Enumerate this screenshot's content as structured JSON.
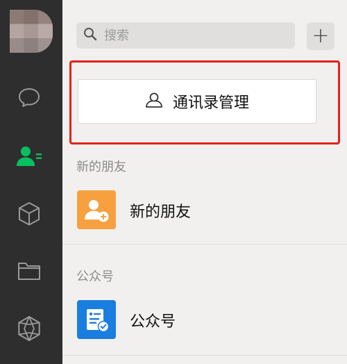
{
  "search": {
    "placeholder": "搜索"
  },
  "toolbar": {
    "add_label": "+"
  },
  "contacts_management": {
    "label": "通讯录管理"
  },
  "sections": [
    {
      "header": "新的朋友",
      "item_title": "新的朋友",
      "icon": "new-friend-icon",
      "color": "#f7a040"
    },
    {
      "header": "公众号",
      "item_title": "公众号",
      "icon": "official-account-icon",
      "color": "#1a7de0"
    }
  ],
  "colors": {
    "active_nav": "#07c160",
    "nav_bg": "#2e2e2e",
    "highlight": "#e5201a"
  }
}
